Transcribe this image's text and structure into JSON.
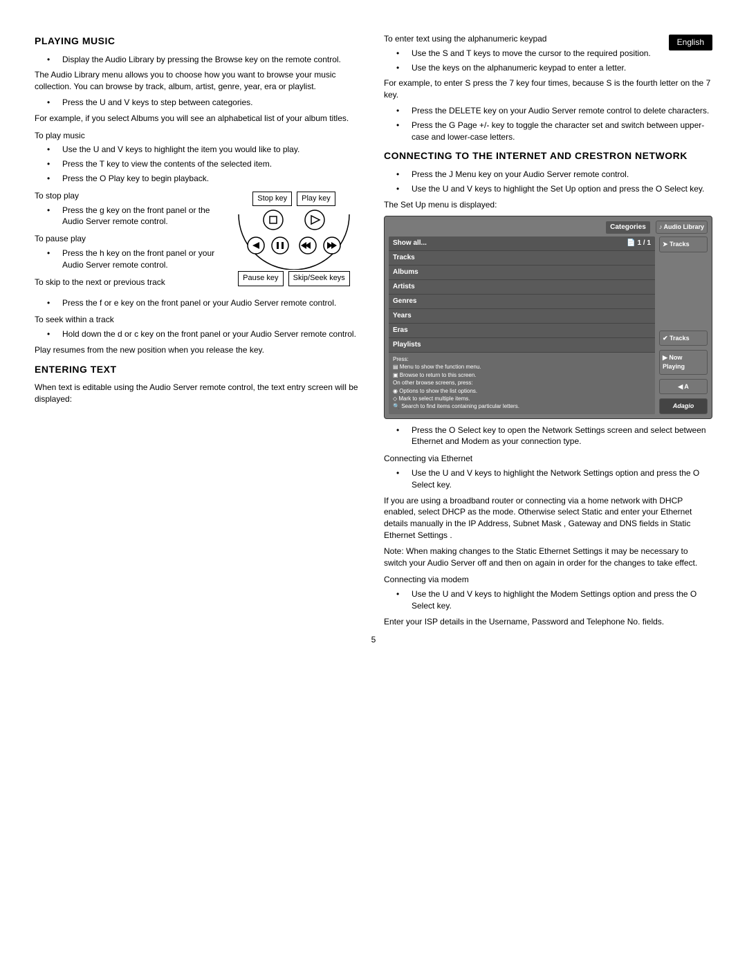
{
  "lang_tab": "English",
  "page_number": "5",
  "left": {
    "h_playing": "PLAYING MUSIC",
    "b_display": "Display the Audio Library  by pressing the    Browse key on the remote control.",
    "p_menu": "The Audio Library  menu allows you to choose how you want to browse your music collection.  You can browse by track, album, artist, genre, year, era or playlist.",
    "b_step": "Press the U  and V  keys to step between categories.",
    "p_albums": "For example, if you select Albums  you will see an alphabetical list of your album titles.",
    "sh_play": "To play music",
    "b_highlight": "Use the U  and V  keys to highlight the item you would like to play.",
    "b_view": "Press the T  key to view the contents of the selected item.",
    "b_playkey": "Press the O Play key to begin playback.",
    "sh_stop": "To stop play",
    "b_stopkey": "Press the g  key on the front panel or the Audio Server remote control.",
    "sh_pause": "To pause play",
    "b_pausekey": "Press the h  key on the front panel or your Audio Server remote control.",
    "sh_skip": "To skip to the next or previous track",
    "b_skipkey": "Press the f   or e  key on the front panel or your Audio Server remote control.",
    "sh_seek": "To seek within a track",
    "b_seekkey": "Hold down the d   or c   key on the front panel or your Audio Server remote control.",
    "p_resume": "Play resumes from the new position when you release the key.",
    "h_entering": "ENTERING TEXT",
    "p_entering": "When text is editable using the Audio Server remote control, the text entry screen will be displayed:",
    "diag_stop": "Stop key",
    "diag_play": "Play key",
    "diag_pause": "Pause key",
    "diag_skip": "Skip/Seek keys"
  },
  "right": {
    "p_enter_keypad": "To enter text using the alphanumeric keypad",
    "b_move_cursor": "Use the S  and T  keys to move the cursor to the required position.",
    "b_enter_letter": "Use the keys on the alphanumeric keypad to enter a letter.",
    "p_example7": "For example, to enter S press the 7 key four times, because S is the fourth letter on the 7 key.",
    "b_delete": "Press the DELETE key on your Audio Server remote control to delete characters.",
    "b_pagepm": "Press the G Page +/- key to toggle the character set and switch between upper-case and lower-case letters.",
    "h_connecting": "CONNECTING TO THE INTERNET AND CRESTRON NETWORK",
    "b_menu": "Press the J Menu  key on your Audio Server remote control.",
    "b_setup": "Use the U  and V  keys to highlight the Set Up option and press the O Select key.",
    "p_setup_shown": "The Set Up menu is displayed:",
    "b_network": "Press the O Select key to open the Network Settings screen and select between Ethernet  and Modem  as your connection type.",
    "sh_eth": "Connecting via Ethernet",
    "b_eth": "Use the U  and V  keys to highlight the Network Settings  option and press the O Select key.",
    "p_dhcp": "If you are using a broadband router or connecting via a home network with DHCP enabled, select DHCP as the mode.  Otherwise select Static and enter your Ethernet details manually in the IP Address, Subnet Mask , Gateway  and DNS fields in Static Ethernet Settings  .",
    "p_note": "Note: When making changes to the Static Ethernet Settings  it may be necessary to switch your Audio Server off and then on again in order for the changes to take effect.",
    "sh_modem": "Connecting via modem",
    "b_modem": "Use the U  and V  keys to highlight the Modem Settings  option and press the O Select key.",
    "p_isp": "Enter your ISP details in the Username, Password and Telephone No.  fields."
  },
  "screenshot": {
    "categories": "Categories",
    "audio_library": "Audio Library",
    "show_all": "Show all...",
    "page": "1 / 1",
    "rows": [
      "Tracks",
      "Albums",
      "Artists",
      "Genres",
      "Years",
      "Eras",
      "Playlists"
    ],
    "r_tracks": "Tracks",
    "r_tracks_check": "Tracks",
    "r_now": "Now Playing",
    "r_a": "A",
    "help_press": "Press:",
    "help_menu": "Menu to show the function menu.",
    "help_browse": "Browse to return to this screen.",
    "help_other": "On other browse screens, press:",
    "help_options": "Options to show the list options.",
    "help_mark": "Mark to select multiple items.",
    "help_search": "Search to find items containing particular letters."
  }
}
